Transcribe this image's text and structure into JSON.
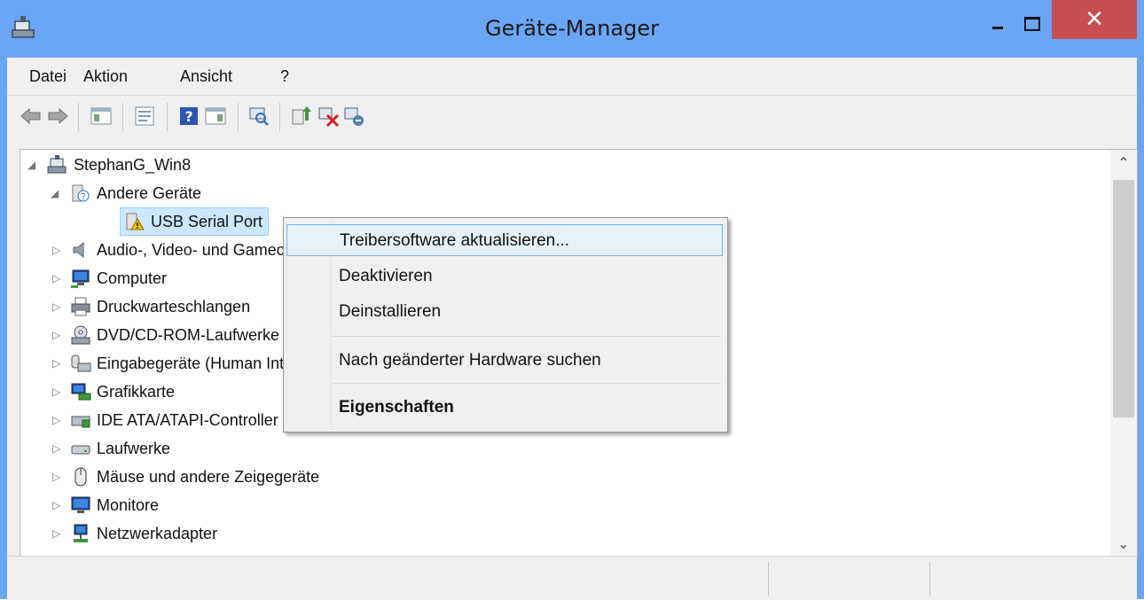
{
  "window": {
    "title": "Geräte-Manager",
    "close_glyph": "✕"
  },
  "menubar": {
    "items": [
      "Datei",
      "Aktion",
      "Ansicht",
      "?"
    ]
  },
  "toolbar": {
    "icons": [
      "back-arrow-icon",
      "forward-arrow-icon",
      "show-hide-console-tree-icon",
      "properties-icon",
      "help-icon",
      "action-pane-icon",
      "scan-hardware-icon",
      "update-driver-icon",
      "disable-device-icon",
      "uninstall-device-icon"
    ]
  },
  "tree": {
    "root": "StephanG_Win8",
    "items": [
      {
        "label": "Andere Geräte",
        "expanded": true
      },
      {
        "label": "USB Serial Port",
        "selected": true
      },
      {
        "label": "Audio-, Video- und Gamecontroller"
      },
      {
        "label": "Computer"
      },
      {
        "label": "Druckwarteschlangen"
      },
      {
        "label": "DVD/CD-ROM-Laufwerke"
      },
      {
        "label": "Eingabegeräte (Human Interface Devices)"
      },
      {
        "label": "Grafikkarte"
      },
      {
        "label": "IDE ATA/ATAPI-Controller"
      },
      {
        "label": "Laufwerke"
      },
      {
        "label": "Mäuse und andere Zeigegeräte"
      },
      {
        "label": "Monitore"
      },
      {
        "label": "Netzwerkadapter"
      }
    ]
  },
  "context_menu": {
    "items": [
      "Treibersoftware aktualisieren...",
      "Deaktivieren",
      "Deinstallieren",
      "Nach geänderter Hardware suchen",
      "Eigenschaften"
    ]
  },
  "colors": {
    "titlebar": "#6aa6f5",
    "close_button": "#c74f4f",
    "selection": "#cce8ff",
    "menu_highlight": "#e5f1fb"
  }
}
